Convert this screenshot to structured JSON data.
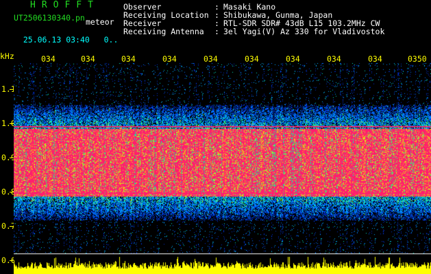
{
  "header": {
    "brand": "HROFFT",
    "filename": "UT2506130340.pn",
    "meteor_label": "meteor",
    "date": "25.06.13",
    "time": "03:40",
    "counter": "0.."
  },
  "meta": [
    {
      "label": "Observer",
      "value": "Masaki Kano"
    },
    {
      "label": "Receiving Location",
      "value": "Shibukawa, Gunma, Japan"
    },
    {
      "label": "Receiver",
      "value": "RTL-SDR SDR# 43dB L15 103.2MHz CW"
    },
    {
      "label": "Receiving Antenna",
      "value": "3el Yagi(V) Az 330 for Vladivostok"
    }
  ],
  "meta_separator": ":",
  "axis": {
    "y_unit": "kHz",
    "y_ticks": [
      "1.1",
      "1.0",
      "0.9",
      "0.8",
      "0.7",
      "0.6"
    ],
    "x_ticks": [
      "034",
      "034",
      "034",
      "034",
      "034",
      "034",
      "034",
      "034",
      "034",
      "0350"
    ]
  },
  "colors": {
    "background": "#000000",
    "header_green": "#22dd22",
    "header_cyan": "#00ffff",
    "axis_yellow": "#ffff00",
    "signal_pink": "#ff1e6e"
  }
}
